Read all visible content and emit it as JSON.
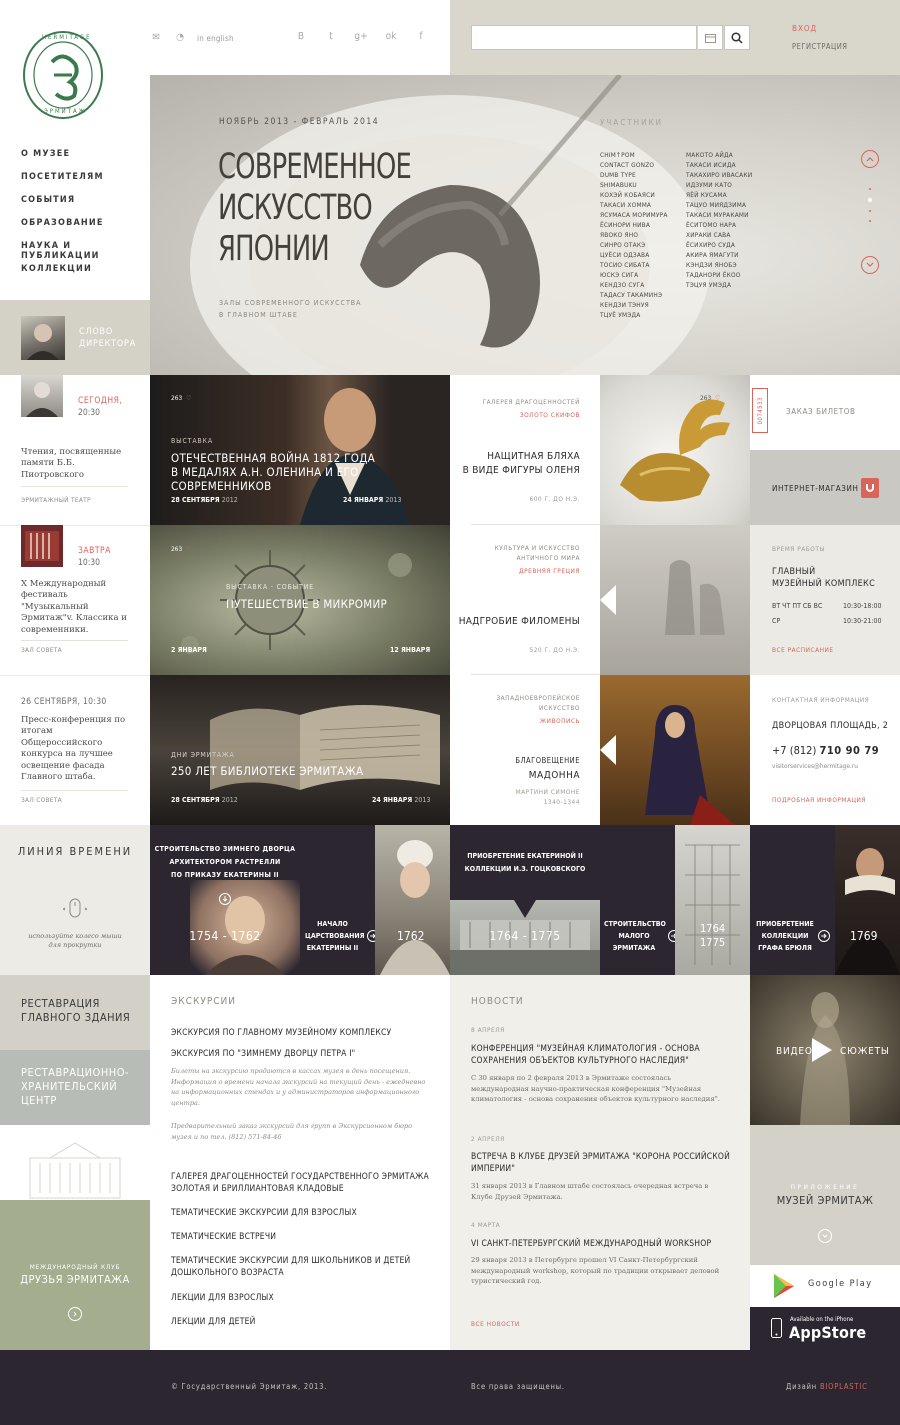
{
  "header": {
    "logo_text_top": "HERMITAGE",
    "logo_text_bottom": "ЭРМИТАЖ",
    "english": "in english",
    "social": [
      "В",
      "t",
      "g+",
      "ok",
      "f"
    ],
    "search_placeholder": "",
    "login": "ВХОД",
    "register": "РЕГИСТРАЦИЯ"
  },
  "nav": [
    "О МУЗЕЕ",
    "ПОСЕТИТЕЛЯМ",
    "СОБЫТИЯ",
    "ОБРАЗОВАНИЕ",
    "НАУКА И ПУБЛИКАЦИИ",
    "КОЛЛЕКЦИИ"
  ],
  "hero": {
    "dates": "НОЯБРЬ 2013 - ФЕВРАЛЬ 2014",
    "title1": "СОВРЕМЕННОЕ",
    "title2": "ИСКУССТВО",
    "title3": "ЯПОНИИ",
    "subtitle1": "ЗАЛЫ СОВРЕМЕННОГО ИСКУССТВА",
    "subtitle2": "В ГЛАВНОМ ШТАБЕ",
    "participants_label": "УЧАСТНИКИ",
    "participants_col1": [
      "CHIM↑POM",
      "CONTACT GONZO",
      "DUMB TYPE",
      "SHIMABUKU",
      "КОХЭЙ КОБАЯСИ",
      "ТАКАСИ ХОММА",
      "ЯСУМАСА МОРИМУРА",
      "ЁСИНОРИ НИВА",
      "ЯВОКО ЯНО",
      "СИНРО ОТАКЭ",
      "ЦУЁСИ ОДЗАВА",
      "ТОСИО СИБАТА",
      "ЮСКЭ СИГА",
      "КЕНДЗО СУГА",
      "ТАДАСУ ТАКАМИНЭ",
      "КЕНДЗИ ТЭНУЯ",
      "ТЦУЁ УМЭДА"
    ],
    "participants_col2": [
      "МАКОТО АЙДА",
      "ТАКАСИ ИСИДА",
      "ТАКАХИРО ИВАСАКИ",
      "ИДЗУМИ КАТО",
      "ЯЁЙ КУСАМА",
      "ТАЦУО МИЯДЗИМА",
      "ТАКАСИ МУРАКАМИ",
      "ЁСИТОМО НАРА",
      "ХИРАКИ САВА",
      "ЁСИХИРО СУДА",
      "АКИРА ЯМАГУТИ",
      "КЭНДЗИ ЯНОБЭ",
      "ТАДАНОРИ ЁКОО",
      "ТЭЦУЯ УМЭДА"
    ]
  },
  "director": {
    "label1": "СЛОВО",
    "label2": "ДИРЕКТОРА"
  },
  "events_left": [
    {
      "day": "СЕГОДНЯ,",
      "time": "20:30",
      "text": "Чтения, посвященные памяти Б.Б. Пиотровского",
      "place": "ЭРМИТАЖНЫЙ ТЕАТР"
    },
    {
      "day": "ЗАВТРА",
      "time": "10:30",
      "text": "X Международный фестиваль \"Музыкальный Эрмитаж\"v. Классика и современники.",
      "place": "ЗАЛ СОВЕТА"
    },
    {
      "day": "26 СЕНТЯБРЯ, 10:30",
      "time": "",
      "text": "Пресс-конференция по итогам Общероссийского конкурса на лучшее освещение фасада Главного штаба.",
      "place": "ЗАЛ СОВЕТА"
    }
  ],
  "exhibits": [
    {
      "likes": "263",
      "kind": "ВЫСТАВКА",
      "title1": "ОТЕЧЕСТВЕННАЯ ВОЙНА 1812 ГОДА",
      "title2": "В МЕДАЛЯХ А.Н. ОЛЕНИНА И ЕГО СОВРЕМЕННИКОВ",
      "from": "28 СЕНТЯБРЯ",
      "from_year": "2012",
      "to": "24 ЯНВАРЯ",
      "to_year": "2013"
    },
    {
      "likes": "263",
      "kind": "ВЫСТАВКА - СОБЫТИЕ",
      "title1": "ПУТЕШЕСТВИЕ В МИКРОМИР",
      "title2": "",
      "from": "2 ЯНВАРЯ",
      "from_year": "",
      "to": "12 ЯНВАРЯ",
      "to_year": ""
    },
    {
      "likes": "",
      "kind": "ДНИ ЭРМИТАЖА",
      "title1": "250 ЛЕТ БИБЛИОТЕКЕ ЭРМИТАЖА",
      "title2": "",
      "from": "28 СЕНТЯБРЯ",
      "from_year": "2012",
      "to": "24 ЯНВАРЯ",
      "to_year": "2013"
    }
  ],
  "artworks": [
    {
      "cat1": "ГАЛЕРЕЯ ДРАГОЦЕННОСТЕЙ",
      "cat2": "ЗОЛОТО СКИФОВ",
      "title1": "НАЩИТНАЯ БЛЯХА",
      "title2": "В ВИДЕ ФИГУРЫ ОЛЕНЯ",
      "date": "600 Г. ДО Н.Э.",
      "likes": "263"
    },
    {
      "cat1": "КУЛЬТУРА И ИСКУССТВО",
      "cat2": "АНТИЧНОГО МИРА",
      "cat3": "ДРЕВНЯЯ ГРЕЦИЯ",
      "title1": "НАДГРОБИЕ ФИЛОМЕНЫ",
      "title2": "",
      "date": "520 Г. ДО Н.Э.",
      "likes": ""
    },
    {
      "cat1": "ЗАПАДНОЕВРОПЕЙСКОЕ",
      "cat2": "ИСКУССТВО",
      "cat3": "ЖИВОПИСЬ",
      "title1": "БЛАГОВЕЩЕНИЕ",
      "title2": "МАДОННА",
      "date": "МАРТИНИ СИМОНЕ",
      "date2": "1340-1344",
      "likes": ""
    }
  ],
  "right": {
    "tickets": "ЗАКАЗ БИЛЕТОВ",
    "ticket_no": "0074533",
    "shop": "ИНТЕРНЕТ-МАГАЗИН",
    "hours_label": "ВРЕМЯ РАБОТЫ",
    "hours_place1": "ГЛАВНЫЙ",
    "hours_place2": "МУЗЕЙНЫЙ КОМПЛЕКС",
    "days1": "ВТ ЧТ ПТ СБ ВС",
    "time1": "10:30-18:00",
    "days2": "СР",
    "time2": "10:30-21:00",
    "schedule": "ВСЕ РАСПИСАНИЕ",
    "contacts_label": "КОНТАКТНАЯ ИНФОРМАЦИЯ",
    "address": "ДВОРЦОВАЯ ПЛОЩАДЬ, 2",
    "phone_prefix": "+7 (812)",
    "phone": "710 90 79",
    "email": "visitorservices@hermitage.ru",
    "more": "ПОДРОБНАЯ ИНФОРМАЦИЯ"
  },
  "timeline": {
    "title": "ЛИНИЯ ВРЕМЕНИ",
    "hint1": "используйте колесо мыши",
    "hint2": "для прокрутки",
    "t1_text1": "СТРОИТЕЛЬСТВО ЗИМНЕГО ДВОРЦА",
    "t1_text2": "АРХИТЕКТОРОМ РАСТРЕЛЛИ",
    "t1_text3": "ПО ПРИКАЗУ ЕКАТЕРИНЫ II",
    "t1_years": "1754 - 1762",
    "t2_text1": "НАЧАЛО",
    "t2_text2": "ЦАРСТВОВАНИЯ",
    "t2_text3": "ЕКАТЕРИНЫ II",
    "t2_year": "1762",
    "t3_text1": "ПРИОБРЕТЕНИЕ ЕКАТЕРИНОЙ II",
    "t3_text2": "КОЛЛЕКЦИИ И.З. ГОЦКОВСКОГО",
    "t3_years": "1764 - 1775",
    "t4_text1": "СТРОИТЕЛЬСТВО",
    "t4_text2": "МАЛОГО",
    "t4_text3": "ЭРМИТАЖА",
    "t4_years": "1764\n1775",
    "t5_text1": "ПРИОБРЕТЕНИЕ",
    "t5_text2": "КОЛЛЕКЦИИ",
    "t5_text3": "ГРАФА БРЮЛЯ",
    "t5_year": "1769"
  },
  "side_blocks": {
    "restoration": "РЕСТАВРАЦИЯ ГЛАВНОГО ЗДАНИЯ",
    "restoration_center": "РЕСТАВРАЦИОННО-ХРАНИТЕЛЬСКИЙ ЦЕНТР",
    "club_label": "МЕЖДУНАРОДНЫЙ КЛУБ",
    "club_title": "ДРУЗЬЯ ЭРМИТАЖА"
  },
  "excursions": {
    "title": "ЭКСКУРСИИ",
    "item1": "ЭКСКУРСИЯ ПО ГЛАВНОМУ МУЗЕЙНОМУ КОМПЛЕКСУ",
    "item2": "ЭКСКУРСИЯ ПО \"ЗИМНЕМУ ДВОРЦУ ПЕТРА I\"",
    "note1": "Билеты на экскурсию продаются в кассах музея в день посещения. Информация о времени начала экскурсий на текущий день - ежедневно на информационных стендах и у администраторов информационного центра.",
    "note2": "Предварительный заказ экскурсий для групп в Экскурсионном бюро музея и по тел. (812) 571-84-46",
    "items": [
      "ГАЛЕРЕЯ ДРАГОЦЕННОСТЕЙ ГОСУДАРСТВЕННОГО ЭРМИТАЖА ЗОЛОТАЯ И БРИЛЛИАНТОВАЯ КЛАДОВЫЕ",
      "ТЕМАТИЧЕСКИЕ ЭКСКУРСИИ ДЛЯ ВЗРОСЛЫХ",
      "ТЕМАТИЧЕСКИЕ ВСТРЕЧИ",
      "ТЕМАТИЧЕСКИЕ ЭКСКУРСИИ ДЛЯ ШКОЛЬНИКОВ И ДЕТЕЙ ДОШКОЛЬНОГО ВОЗРАСТА",
      "ЛЕКЦИИ ДЛЯ ВЗРОСЛЫХ",
      "ЛЕКЦИИ ДЛЯ ДЕТЕЙ"
    ]
  },
  "news": {
    "title": "НОВОСТИ",
    "items": [
      {
        "date": "8 АПРЕЛЯ",
        "title": "КОНФЕРЕНЦИЯ \"МУЗЕЙНАЯ КЛИМАТОЛОГИЯ - ОСНОВА СОХРАНЕНИЯ ОБЪЕКТОВ КУЛЬТУРНОГО НАСЛЕДИЯ\"",
        "text": "С 30 января по 2 февраля 2013 в Эрмитаже состоялась международная научно-практическая конференция \"Музейная климатология - основа сохранения объектов культурного наследия\"."
      },
      {
        "date": "2 АПРЕЛЯ",
        "title": "ВСТРЕЧА В КЛУБЕ ДРУЗЕЙ ЭРМИТАЖА \"КОРОНА РОССИЙСКОЙ ИМПЕРИИ\"",
        "text": "31 января 2013 в Главном штабе состоялась очередная встреча в Клубе Друзей Эрмитажа."
      },
      {
        "date": "4 МАРТА",
        "title": "VI САНКТ-ПЕТЕРБУРГСКИЙ МЕЖДУНАРОДНЫЙ WORKSHOP",
        "text": "29 января 2013 в Петербурге прошел VI Санкт-Петербургский международный workshop, который по традиции открывает деловой туристический год."
      }
    ],
    "all": "ВСЕ НОВОСТИ"
  },
  "media": {
    "video": "ВИДЕО",
    "stories": "СЮЖЕТЫ",
    "app_label": "ПРИЛОЖЕНИЕ",
    "app_title": "МУЗЕЙ ЭРМИТАЖ",
    "google": "Google Play",
    "apple_small": "Available on the iPhone",
    "apple": "AppStore"
  },
  "footer": {
    "copyright": "© Государственный Эрмитаж, 2013.",
    "rights": "Все права защищены.",
    "design": "Дизайн",
    "designer": "BIOPLASTIC"
  },
  "colors": {
    "accent": "#d9655a",
    "dark": "#2b2630",
    "sage": "#a3ac8c",
    "gray_block": "#cfcdc4",
    "blue_gray": "#b7bcb8"
  }
}
